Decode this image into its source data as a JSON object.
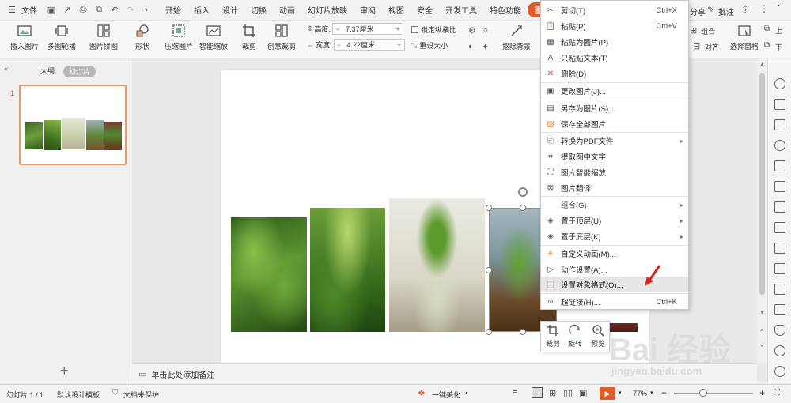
{
  "menubar": {
    "file": "文件",
    "tabs": [
      "开始",
      "插入",
      "设计",
      "切换",
      "动画",
      "幻灯片放映",
      "审阅",
      "视图",
      "安全",
      "开发工具",
      "特色功能"
    ],
    "active_tab": "图片工具",
    "share": "分享",
    "comment": "批注"
  },
  "ribbon": {
    "insert_image": "插入图片",
    "multi_outline": "多图轮播",
    "image_collage": "图片拼图",
    "shape": "形状",
    "compress": "压缩图片",
    "smart_scale": "智能缩放",
    "crop": "裁剪",
    "creative_crop": "创意裁剪",
    "height_label": "高度:",
    "height_value": "7.37厘米",
    "width_label": "宽度:",
    "width_value": "4.22厘米",
    "lock_ratio": "锁定纵横比",
    "reset_size": "重设大小",
    "remove_bg": "抠除背景",
    "group": "组合",
    "align": "对齐",
    "selection_pane": "选择窗格",
    "move_up": "上",
    "move_down": "下"
  },
  "leftpanel": {
    "tab_outline": "大纲",
    "tab_slides": "幻灯片",
    "slide_number": "1",
    "add": "+"
  },
  "context_menu": {
    "items": [
      {
        "label": "剪切(T)",
        "shortcut": "Ctrl+X",
        "icon": "scissors-icon"
      },
      {
        "label": "粘贴(P)",
        "shortcut": "Ctrl+V",
        "icon": "paste-icon"
      },
      {
        "label": "粘贴为图片(P)",
        "shortcut": "",
        "icon": "paste-image-icon"
      },
      {
        "label": "只粘贴文本(T)",
        "shortcut": "",
        "icon": "paste-text-icon"
      },
      {
        "label": "删除(D)",
        "shortcut": "",
        "icon": "delete-icon"
      },
      {
        "label": "更改图片(J)...",
        "shortcut": "",
        "icon": "change-image-icon"
      },
      {
        "label": "另存为图片(S)...",
        "shortcut": "",
        "icon": "save-image-icon"
      },
      {
        "label": "保存全部图片",
        "shortcut": "",
        "icon": "save-all-icon"
      },
      {
        "label": "转换为PDF文件",
        "shortcut": "",
        "icon": "pdf-icon"
      },
      {
        "label": "提取图中文字",
        "shortcut": "",
        "icon": "ocr-icon"
      },
      {
        "label": "图片智能缩放",
        "shortcut": "",
        "icon": "smart-scale-icon"
      },
      {
        "label": "图片翻译",
        "shortcut": "",
        "icon": "translate-icon"
      },
      {
        "label": "组合(G)",
        "shortcut": "",
        "icon": ""
      },
      {
        "label": "置于顶层(U)",
        "shortcut": "",
        "icon": "bring-front-icon"
      },
      {
        "label": "置于底层(K)",
        "shortcut": "",
        "icon": "send-back-icon"
      },
      {
        "label": "自定义动画(M)...",
        "shortcut": "",
        "icon": "animation-icon"
      },
      {
        "label": "动作设置(A)...",
        "shortcut": "",
        "icon": "action-icon"
      },
      {
        "label": "设置对象格式(O)...",
        "shortcut": "",
        "icon": "format-object-icon"
      },
      {
        "label": "超链接(H)...",
        "shortcut": "Ctrl+K",
        "icon": "hyperlink-icon"
      }
    ]
  },
  "minibar": {
    "crop": "裁剪",
    "rotate": "旋转",
    "preview": "预览"
  },
  "notes": {
    "placeholder": "单击此处添加备注"
  },
  "statusbar": {
    "slide_info": "幻灯片 1 / 1",
    "template": "默认设计模板",
    "protect": "文档未保护",
    "beautify": "一键美化",
    "zoom": "77%"
  },
  "watermark": {
    "brand": "Bai 经验",
    "url": "jingyan.baidu.com"
  },
  "colors": {
    "accent": "#e05d2b",
    "highlight": "#e6e6e6"
  }
}
